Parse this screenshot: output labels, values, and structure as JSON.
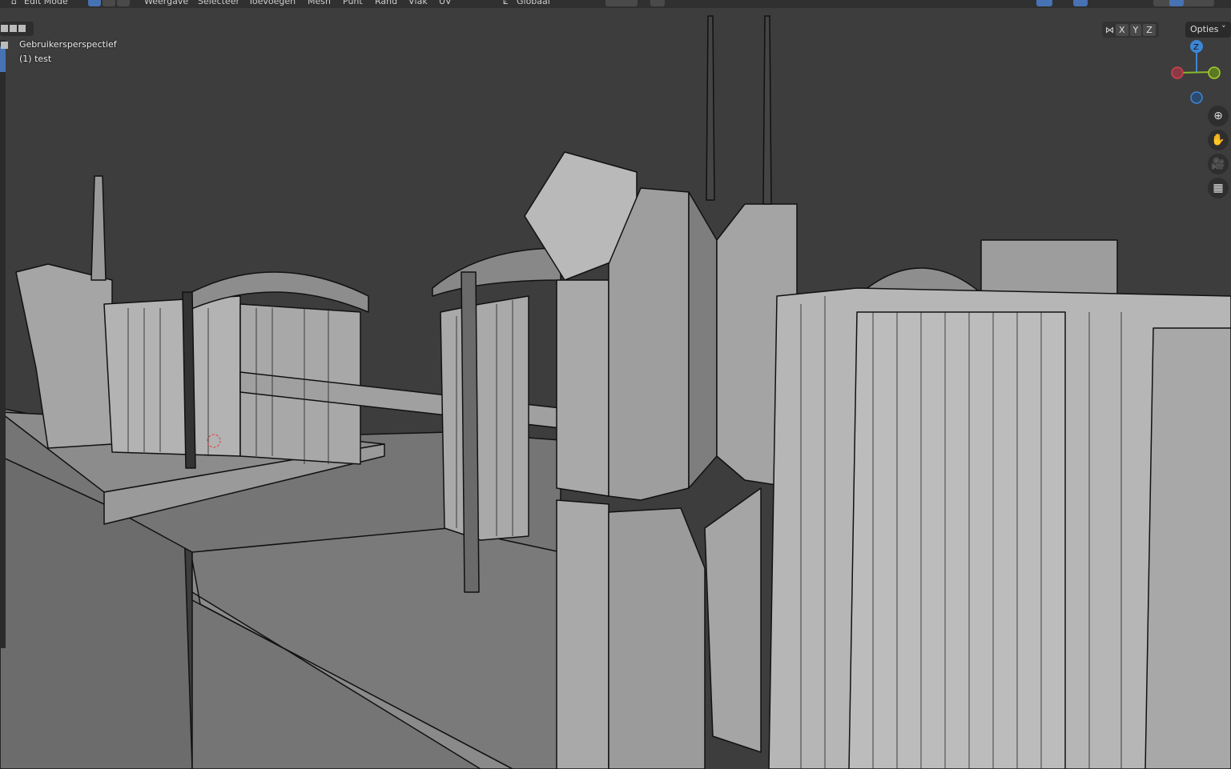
{
  "header": {
    "mode": "Edit Mode",
    "menus": [
      "Weergave",
      "Selecteer",
      "Toevoegen",
      "Mesh",
      "Punt",
      "Rand",
      "Vlak",
      "UV"
    ],
    "orientation": "Globaal"
  },
  "viewport": {
    "view_name": "Gebruikersperspectief",
    "object_label": "(1) test"
  },
  "mirror": {
    "axes": [
      "X",
      "Y",
      "Z"
    ],
    "options_label": "Opties"
  },
  "gizmo": {
    "z_label": "Z",
    "colors": {
      "x": "#d6404e",
      "y": "#8ab82a",
      "z": "#3d86d6"
    }
  },
  "nav": {
    "icons": [
      "zoom-icon",
      "hand-pan-icon",
      "camera-icon",
      "ortho-grid-icon"
    ]
  }
}
